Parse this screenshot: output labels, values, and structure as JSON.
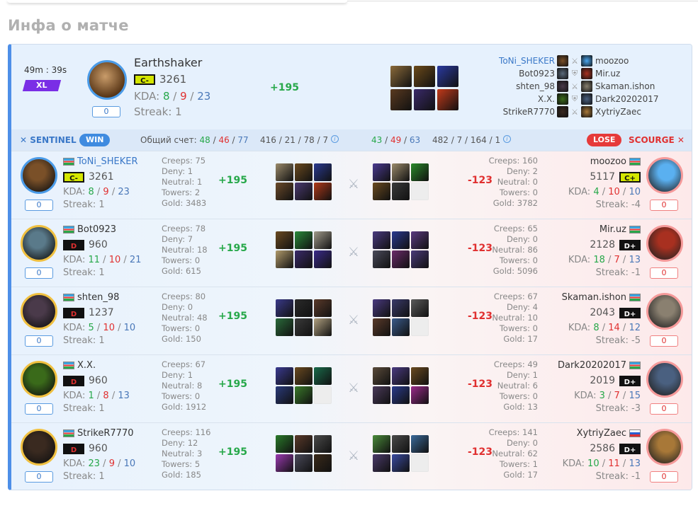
{
  "page_title": "Инфа о матче",
  "header": {
    "duration": "49m : 39s",
    "mode": "XL",
    "hero": "Earthshaker",
    "rank": "C-",
    "mmr": "3261",
    "kda_label": "KDA:",
    "kda": {
      "k": "8",
      "d": "9",
      "a": "23"
    },
    "streak": "Streak: 1",
    "counter": "0",
    "delta": "+195",
    "items": [
      "#8a6a3a",
      "#6b4a1a",
      "#2a3aa0",
      "#5a3a20",
      "#3a2a6a",
      "#c23a1a"
    ]
  },
  "roster": [
    {
      "left": "ToNi_SHEKER",
      "right": "moozoo",
      "lc": "#7a5028",
      "rc": "#4aa6f0",
      "mid": "swords"
    },
    {
      "left": "Bot0923",
      "right": "Mir.uz",
      "lc": "#5a6a7a",
      "rc": "#a83020",
      "mid": "shield"
    },
    {
      "left": "shten_98",
      "right": "Skaman.ishon",
      "lc": "#4a3a4a",
      "rc": "#888070",
      "mid": "swords"
    },
    {
      "left": "X.X.",
      "right": "Dark20202017",
      "lc": "#3a6a1a",
      "rc": "#4a6080",
      "mid": "shield"
    },
    {
      "left": "StrikeR7770",
      "right": "XytriyZaec",
      "lc": "#3a2a20",
      "rc": "#a87838",
      "mid": "swords"
    }
  ],
  "teams": {
    "sentinel": "SENTINEL",
    "win": "WIN",
    "score_label": "Общий счет:",
    "s1": "48",
    "s2": "46",
    "s3": "77",
    "lstats": "416 / 21 / 78 / 7",
    "r1": "43",
    "r2": "49",
    "r3": "63",
    "rstats": "482 / 7 / 164 / 1",
    "lose": "LOSE",
    "scourge": "SCOURGE"
  },
  "rows": [
    {
      "l": {
        "name": "ToNi_SHEKER",
        "hl": true,
        "rank": "C-",
        "rc": "cm",
        "mmr": "3261",
        "k": "8",
        "d": "9",
        "a": "23",
        "streak": "Streak: 1",
        "ctr": "0",
        "creeps": "Creeps: 75",
        "deny": "Deny: 1",
        "neutral": "Neutral: 1",
        "towers": "Towers: 2",
        "gold": "Gold: 3483",
        "delta": "+195",
        "ava": "#7a5028",
        "gold_ring": false,
        "items": [
          "#9a8a6a",
          "#6a4a20",
          "#2a3a90",
          "#6a4a2a",
          "#4a3a70",
          "#b03a1a"
        ]
      },
      "r": {
        "name": "moozoo",
        "rank": "C+",
        "rc": "cp",
        "mmr": "5117",
        "k": "4",
        "d": "10",
        "a": "10",
        "streak": "Streak: -4",
        "ctr": "0",
        "creeps": "Creeps: 160",
        "deny": "Deny: 2",
        "neutral": "Neutral: 0",
        "towers": "Towers: 0",
        "gold": "Gold: 3782",
        "delta": "-123",
        "ava": "#5ab0f0",
        "items": [
          "#4a3a90",
          "#9a8a6a",
          "#2a8a2a",
          "#6a4a20",
          "#3a3a3a",
          ""
        ]
      }
    },
    {
      "l": {
        "name": "Bot0923",
        "hl": false,
        "rank": "D",
        "rc": "d",
        "mmr": "960",
        "k": "11",
        "d": "10",
        "a": "21",
        "streak": "Streak: 1",
        "ctr": "0",
        "creeps": "Creeps: 78",
        "deny": "Deny: 7",
        "neutral": "Neutral: 18",
        "towers": "Towers: 0",
        "gold": "Gold: 615",
        "delta": "+195",
        "ava": "#5a7a8a",
        "gold_ring": true,
        "items": [
          "#6a4a20",
          "#2a8a3a",
          "#a09a8a",
          "#b09a6a",
          "#3a2a6a",
          "#3a2a8a"
        ]
      },
      "r": {
        "name": "Mir.uz",
        "rank": "D+",
        "rc": "dp",
        "mmr": "2128",
        "k": "18",
        "d": "7",
        "a": "13",
        "streak": "Streak: -1",
        "ctr": "0",
        "creeps": "Creeps: 65",
        "deny": "Deny: 0",
        "neutral": "Neutral: 86",
        "towers": "Towers: 0",
        "gold": "Gold: 5096",
        "delta": "-123",
        "ava": "#a83020",
        "items": [
          "#4a3a80",
          "#2a3a90",
          "#5a3a80",
          "#4a4a5a",
          "#6a2a6a",
          "#4a3a7a"
        ]
      }
    },
    {
      "l": {
        "name": "shten_98",
        "hl": false,
        "rank": "D",
        "rc": "d",
        "mmr": "1237",
        "k": "5",
        "d": "10",
        "a": "10",
        "streak": "Streak: 1",
        "ctr": "0",
        "creeps": "Creeps: 80",
        "deny": "Deny: 0",
        "neutral": "Neutral: 48",
        "towers": "Towers: 0",
        "gold": "Gold: 150",
        "delta": "+195",
        "ava": "#4a3a4a",
        "gold_ring": true,
        "items": [
          "#3a3a8a",
          "#2a2a2a",
          "#5a3a2a",
          "#2a6a3a",
          "#3a3a3a",
          "#b0a080"
        ]
      },
      "r": {
        "name": "Skaman.ishon",
        "rank": "D+",
        "rc": "dp",
        "mmr": "2043",
        "k": "8",
        "d": "14",
        "a": "12",
        "streak": "Streak: -5",
        "ctr": "0",
        "creeps": "Creeps: 67",
        "deny": "Deny: 4",
        "neutral": "Neutral: 10",
        "towers": "Towers: 0",
        "gold": "Gold: 17",
        "delta": "-123",
        "ava": "#8a8070",
        "items": [
          "#4a3a80",
          "#3a3a6a",
          "#5a5a5a",
          "#5a3a2a",
          "#3a5a8a",
          ""
        ]
      }
    },
    {
      "l": {
        "name": "X.X.",
        "hl": false,
        "rank": "D",
        "rc": "d",
        "mmr": "960",
        "k": "1",
        "d": "8",
        "a": "13",
        "streak": "Streak: 1",
        "ctr": "0",
        "creeps": "Creeps: 67",
        "deny": "Deny: 1",
        "neutral": "Neutral: 8",
        "towers": "Towers: 0",
        "gold": "Gold: 1912",
        "delta": "+195",
        "ava": "#3a6a1a",
        "gold_ring": true,
        "items": [
          "#3a3a90",
          "#6a4a20",
          "#1a6a4a",
          "#2a3a7a",
          "#3a7a2a",
          ""
        ]
      },
      "r": {
        "name": "Dark20202017",
        "rank": "D+",
        "rc": "dp",
        "mmr": "2019",
        "k": "3",
        "d": "7",
        "a": "15",
        "streak": "Streak: -3",
        "ctr": "0",
        "creeps": "Creeps: 49",
        "deny": "Deny: 1",
        "neutral": "Neutral: 6",
        "towers": "Towers: 0",
        "gold": "Gold: 13",
        "delta": "-123",
        "ava": "#4a6080",
        "items": [
          "#5a4a3a",
          "#4a3a80",
          "#6a4a20",
          "#4a3a5a",
          "#2a3a8a",
          "#9a2a8a"
        ]
      }
    },
    {
      "l": {
        "name": "StrikeR7770",
        "hl": false,
        "rank": "D",
        "rc": "d",
        "mmr": "960",
        "k": "23",
        "d": "9",
        "a": "10",
        "streak": "Streak: 1",
        "ctr": "0",
        "creeps": "Creeps: 116",
        "deny": "Deny: 12",
        "neutral": "Neutral: 3",
        "towers": "Towers: 5",
        "gold": "Gold: 185",
        "delta": "+195",
        "ava": "#3a2a20",
        "gold_ring": true,
        "items": [
          "#2a7a2a",
          "#5a3a2a",
          "#4a4a4a",
          "#9a3ab0",
          "#4a4a5a",
          "#3a2a1a"
        ]
      },
      "r": {
        "name": "XytriyZaec",
        "rank": "D+",
        "rc": "dp",
        "mmr": "2586",
        "k": "10",
        "d": "11",
        "a": "13",
        "streak": "Streak: -1",
        "ctr": "0",
        "creeps": "Creeps: 141",
        "deny": "Deny: 0",
        "neutral": "Neutral: 62",
        "towers": "Towers: 1",
        "gold": "Gold: 17",
        "delta": "-123",
        "ava": "#a87838",
        "items": [
          "#4a8a3a",
          "#4a4a4a",
          "#3a6a9a",
          "#4a3a6a",
          "#3a4aa0",
          ""
        ]
      }
    }
  ]
}
